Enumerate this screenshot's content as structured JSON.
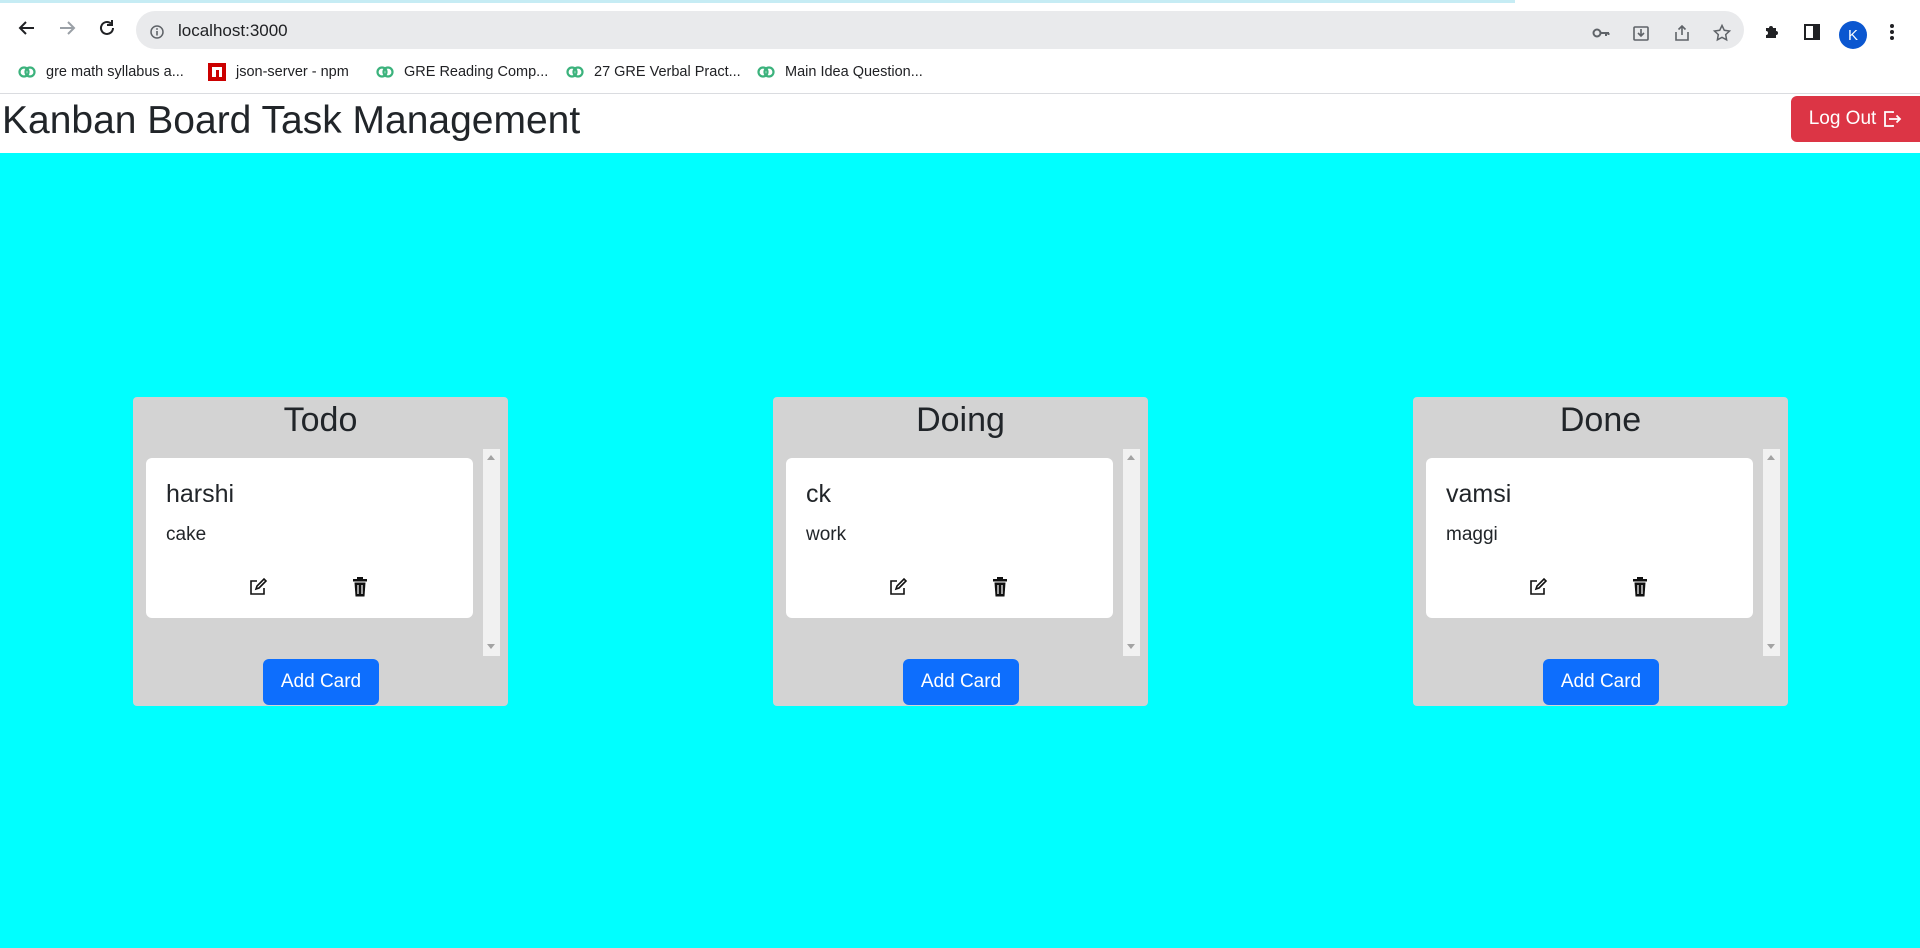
{
  "browser": {
    "url": "localhost:3000",
    "avatar_initial": "K",
    "bookmarks": [
      {
        "label": "gre math syllabus a...",
        "icon": "green-favicon-icon"
      },
      {
        "label": "json-server - npm",
        "icon": "npm-icon"
      },
      {
        "label": "GRE Reading Comp...",
        "icon": "green-favicon-icon"
      },
      {
        "label": "27 GRE Verbal Pract...",
        "icon": "green-favicon-icon"
      },
      {
        "label": "Main Idea Question...",
        "icon": "green-favicon-icon"
      }
    ]
  },
  "header": {
    "title": "Kanban Board Task Management",
    "logout_label": "Log Out"
  },
  "colors": {
    "board_background": "#00ffff",
    "column_background": "#d3d3d3",
    "primary_button": "#0d6efd",
    "danger_button": "#dc3545"
  },
  "columns": [
    {
      "title": "Todo",
      "cards": [
        {
          "title": "harshi",
          "description": "cake"
        }
      ],
      "add_label": "Add Card"
    },
    {
      "title": "Doing",
      "cards": [
        {
          "title": "ck",
          "description": "work"
        }
      ],
      "add_label": "Add Card"
    },
    {
      "title": "Done",
      "cards": [
        {
          "title": "vamsi",
          "description": "maggi"
        }
      ],
      "add_label": "Add Card"
    }
  ]
}
